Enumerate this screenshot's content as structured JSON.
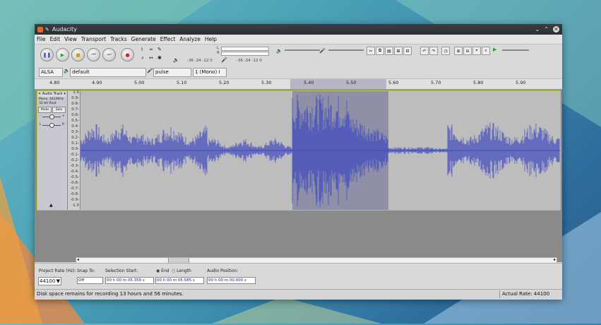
{
  "window": {
    "title": "Audacity"
  },
  "menu": [
    "File",
    "Edit",
    "View",
    "Transport",
    "Tracks",
    "Generate",
    "Effect",
    "Analyze",
    "Help"
  ],
  "meters": {
    "rec_labels": [
      "L",
      "R"
    ],
    "scale_a": "-36 -24 -12 0",
    "scale_b": "-36 -24 -12 0"
  },
  "devices": {
    "host": "ALSA",
    "output": "default",
    "input": "pulse",
    "channels": "1 (Mono) I"
  },
  "ruler_ticks": [
    "4.80",
    "4.90",
    "5.00",
    "5.10",
    "5.20",
    "5.30",
    "5.40",
    "5.50",
    "5.60",
    "5.70",
    "5.80",
    "5.90"
  ],
  "track": {
    "name": "Audio Track",
    "info1": "Mono, 44100Hz",
    "info2": "32-bit float",
    "mute": "Mute",
    "solo": "Solo",
    "gain_minus": "-",
    "gain_plus": "+",
    "pan_l": "L",
    "pan_r": "R",
    "scale": [
      "1.0",
      "0.9-",
      "0.8-",
      "0.7-",
      "0.6-",
      "0.5-",
      "0.4-",
      "0.3-",
      "0.2-",
      "0.1-",
      "0.0-",
      "-0.1-",
      "-0.2-",
      "-0.3-",
      "-0.4-",
      "-0.5-",
      "-0.6-",
      "-0.7-",
      "-0.8-",
      "-0.9-",
      "-1.0"
    ]
  },
  "selection_bar": {
    "project_rate_label": "Project Rate (Hz):",
    "project_rate": "44100",
    "snap_label": "Snap To:",
    "snap": "Off",
    "sel_start_label": "Selection Start:",
    "end_label": "End",
    "length_label": "Length",
    "audio_pos_label": "Audio Position:",
    "sel_start": "00 h 00 m 05.359 s",
    "sel_end": "00 h 00 m 05.585 s",
    "audio_pos": "00 h 00 m 00.000 s"
  },
  "status": {
    "disk": "Disk space remains for recording 13 hours and 56 minutes.",
    "rate": "Actual Rate: 44100"
  },
  "colors": {
    "wave": "#3c46c0",
    "selection": "#8f8fa8",
    "track_border": "#b7cc3c",
    "record": "#cc2222",
    "play": "#22aa22"
  }
}
